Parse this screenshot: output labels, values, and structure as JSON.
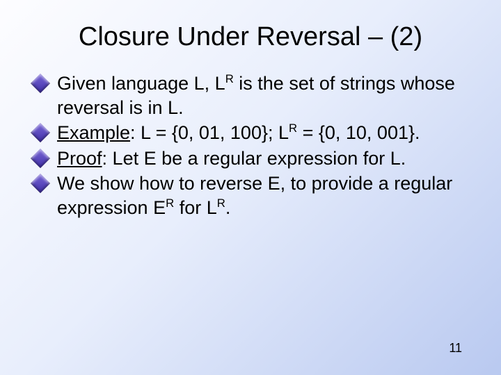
{
  "title": "Closure Under Reversal – (2)",
  "bullets": [
    {
      "prefix": "Given language L, L",
      "sup1": "R",
      "rest1": " is the set of strings whose reversal is in L."
    },
    {
      "label": "Example",
      "after_label": ": L = {0, 01, 100}; L",
      "sup1": "R",
      "rest1": " = {0, 10, 001}."
    },
    {
      "label": "Proof",
      "after_label": ": Let E be a regular expression for L."
    },
    {
      "prefix": "We show how to reverse E, to provide a regular expression E",
      "sup1": "R",
      "rest1": " for L",
      "sup2": "R",
      "rest2": "."
    }
  ],
  "page_number": "11"
}
